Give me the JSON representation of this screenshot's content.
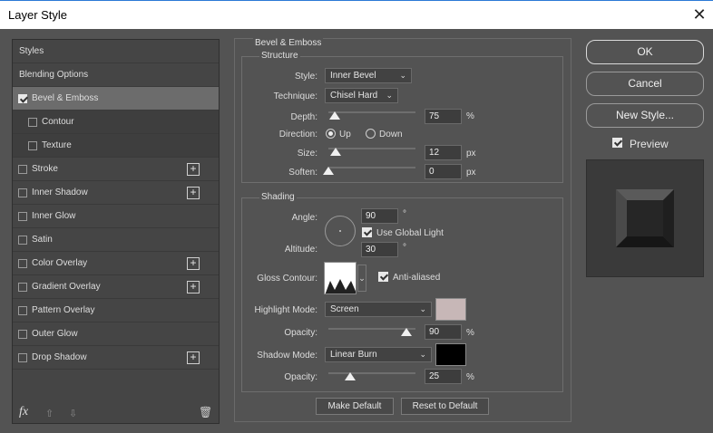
{
  "window": {
    "title": "Layer Style",
    "close_glyph": "✕"
  },
  "styles_panel": {
    "items": [
      {
        "label": "Styles",
        "checkbox": false,
        "plus": false,
        "selected": false,
        "sub": false
      },
      {
        "label": "Blending Options",
        "checkbox": false,
        "plus": false,
        "selected": false,
        "sub": false
      },
      {
        "label": "Bevel & Emboss",
        "checkbox": true,
        "checked": true,
        "plus": false,
        "selected": true,
        "sub": false
      },
      {
        "label": "Contour",
        "checkbox": true,
        "checked": false,
        "plus": false,
        "selected": false,
        "sub": true
      },
      {
        "label": "Texture",
        "checkbox": true,
        "checked": false,
        "plus": false,
        "selected": false,
        "sub": true
      },
      {
        "label": "Stroke",
        "checkbox": true,
        "checked": false,
        "plus": true,
        "selected": false,
        "sub": false
      },
      {
        "label": "Inner Shadow",
        "checkbox": true,
        "checked": false,
        "plus": true,
        "selected": false,
        "sub": false
      },
      {
        "label": "Inner Glow",
        "checkbox": true,
        "checked": false,
        "plus": false,
        "selected": false,
        "sub": false
      },
      {
        "label": "Satin",
        "checkbox": true,
        "checked": false,
        "plus": false,
        "selected": false,
        "sub": false
      },
      {
        "label": "Color Overlay",
        "checkbox": true,
        "checked": false,
        "plus": true,
        "selected": false,
        "sub": false
      },
      {
        "label": "Gradient Overlay",
        "checkbox": true,
        "checked": false,
        "plus": true,
        "selected": false,
        "sub": false
      },
      {
        "label": "Pattern Overlay",
        "checkbox": true,
        "checked": false,
        "plus": false,
        "selected": false,
        "sub": false
      },
      {
        "label": "Outer Glow",
        "checkbox": true,
        "checked": false,
        "plus": false,
        "selected": false,
        "sub": false
      },
      {
        "label": "Drop Shadow",
        "checkbox": true,
        "checked": false,
        "plus": true,
        "selected": false,
        "sub": false
      }
    ],
    "footer": {
      "fx": "fx",
      "up_glyph": "⇧",
      "down_glyph": "⇩",
      "trash_glyph": "🗑"
    }
  },
  "bevel": {
    "section": "Bevel & Emboss",
    "structure": {
      "title": "Structure",
      "style_label": "Style:",
      "style_value": "Inner Bevel",
      "technique_label": "Technique:",
      "technique_value": "Chisel Hard",
      "depth_label": "Depth:",
      "depth_value": "75",
      "depth_unit": "%",
      "depth_level": 0.075,
      "direction_label": "Direction:",
      "direction_up": "Up",
      "direction_down": "Down",
      "direction_selected": "Up",
      "size_label": "Size:",
      "size_value": "12",
      "size_unit": "px",
      "size_level": 0.08,
      "soften_label": "Soften:",
      "soften_value": "0",
      "soften_unit": "px",
      "soften_level": 0.0
    },
    "shading": {
      "title": "Shading",
      "angle_label": "Angle:",
      "angle_value": "90",
      "angle_unit": "°",
      "global_light_label": "Use Global Light",
      "global_light_checked": true,
      "altitude_label": "Altitude:",
      "altitude_value": "30",
      "altitude_unit": "°",
      "gloss_label": "Gloss Contour:",
      "antialias_label": "Anti-aliased",
      "antialias_checked": true,
      "highlight_label": "Highlight Mode:",
      "highlight_value": "Screen",
      "highlight_color": "#c7b7b7",
      "hl_opacity_label": "Opacity:",
      "hl_opacity_value": "90",
      "hl_opacity_unit": "%",
      "hl_opacity_level": 0.9,
      "shadow_label": "Shadow Mode:",
      "shadow_value": "Linear Burn",
      "shadow_color": "#000000",
      "sh_opacity_label": "Opacity:",
      "sh_opacity_value": "25",
      "sh_opacity_unit": "%",
      "sh_opacity_level": 0.25
    },
    "make_default": "Make Default",
    "reset_default": "Reset to Default"
  },
  "actions": {
    "ok": "OK",
    "cancel": "Cancel",
    "new_style": "New Style...",
    "preview": "Preview",
    "preview_checked": true
  }
}
